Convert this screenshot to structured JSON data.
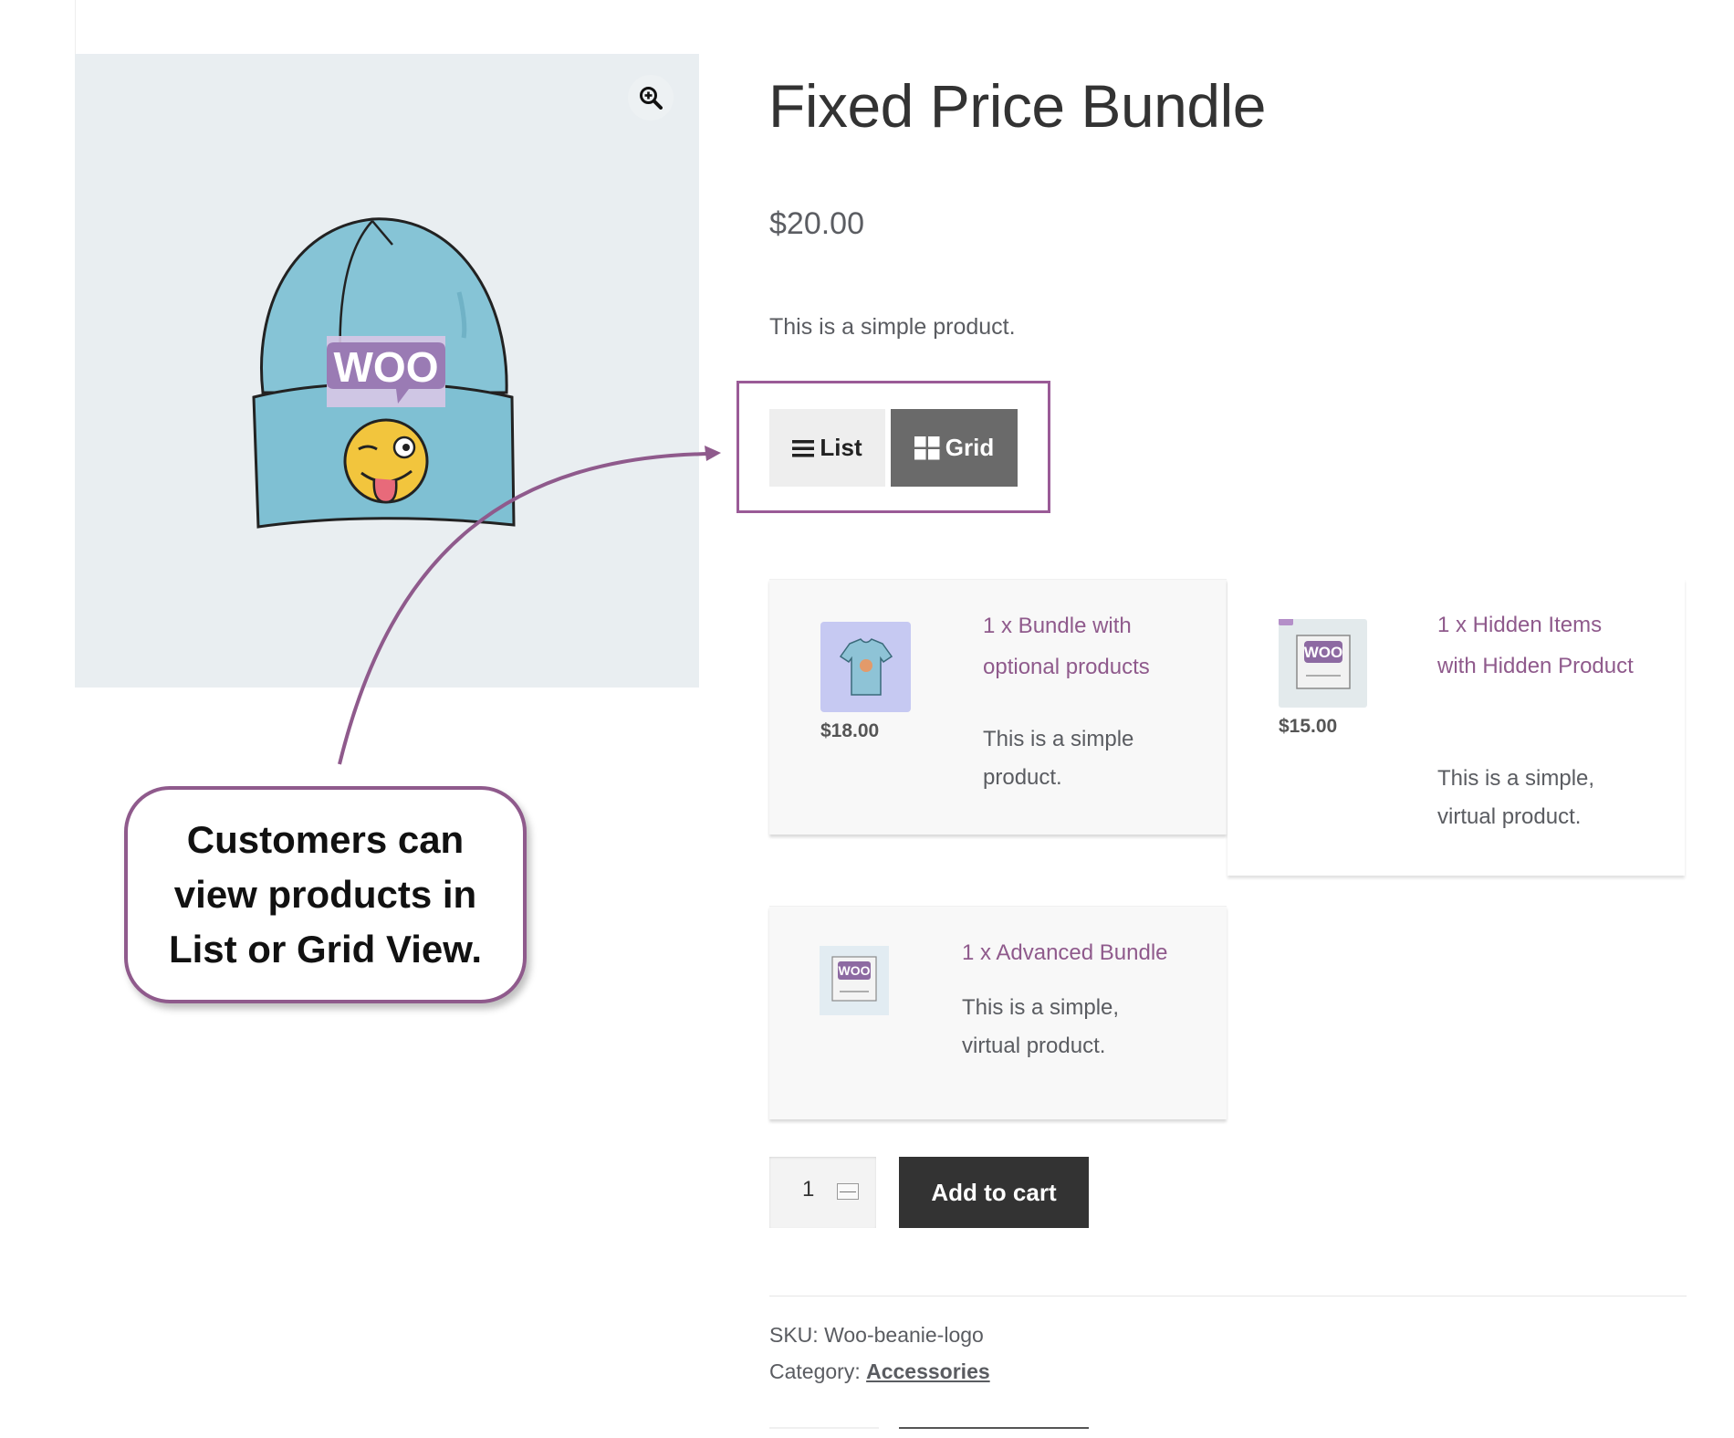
{
  "product": {
    "title": "Fixed Price Bundle",
    "price": "$20.00",
    "short_description": "This is a simple product.",
    "image_logo_text": "Woo"
  },
  "view_toggle": {
    "list_label": "List",
    "grid_label": "Grid",
    "selected": "Grid"
  },
  "bundle_items": [
    {
      "title": "1 x Bundle with optional products",
      "price": "$18.00",
      "description": "This is a simple product.",
      "icon": "tshirt-thumbnail"
    },
    {
      "title": "1 x Hidden Items with Hidden Product",
      "price": "$15.00",
      "description": "This is a simple, virtual product.",
      "icon": "woo-album-thumbnail"
    },
    {
      "title": "1 x Advanced Bundle",
      "price": "",
      "description": "This is a simple, virtual product.",
      "icon": "woo-single-thumbnail"
    }
  ],
  "cart": {
    "quantity": "1",
    "add_to_cart_label": "Add to cart"
  },
  "meta": {
    "sku_label": "SKU:",
    "sku_value": "Woo-beanie-logo",
    "category_label": "Category:",
    "category_value": "Accessories"
  },
  "callout": {
    "text": "Customers can view products in List or Grid View."
  },
  "colors": {
    "accent_purple": "#8f5a8c",
    "cart_button": "#333333",
    "grid_button_active": "#6a6a6a",
    "list_button": "#eeeeee",
    "gallery_bg": "#e9eef1"
  }
}
